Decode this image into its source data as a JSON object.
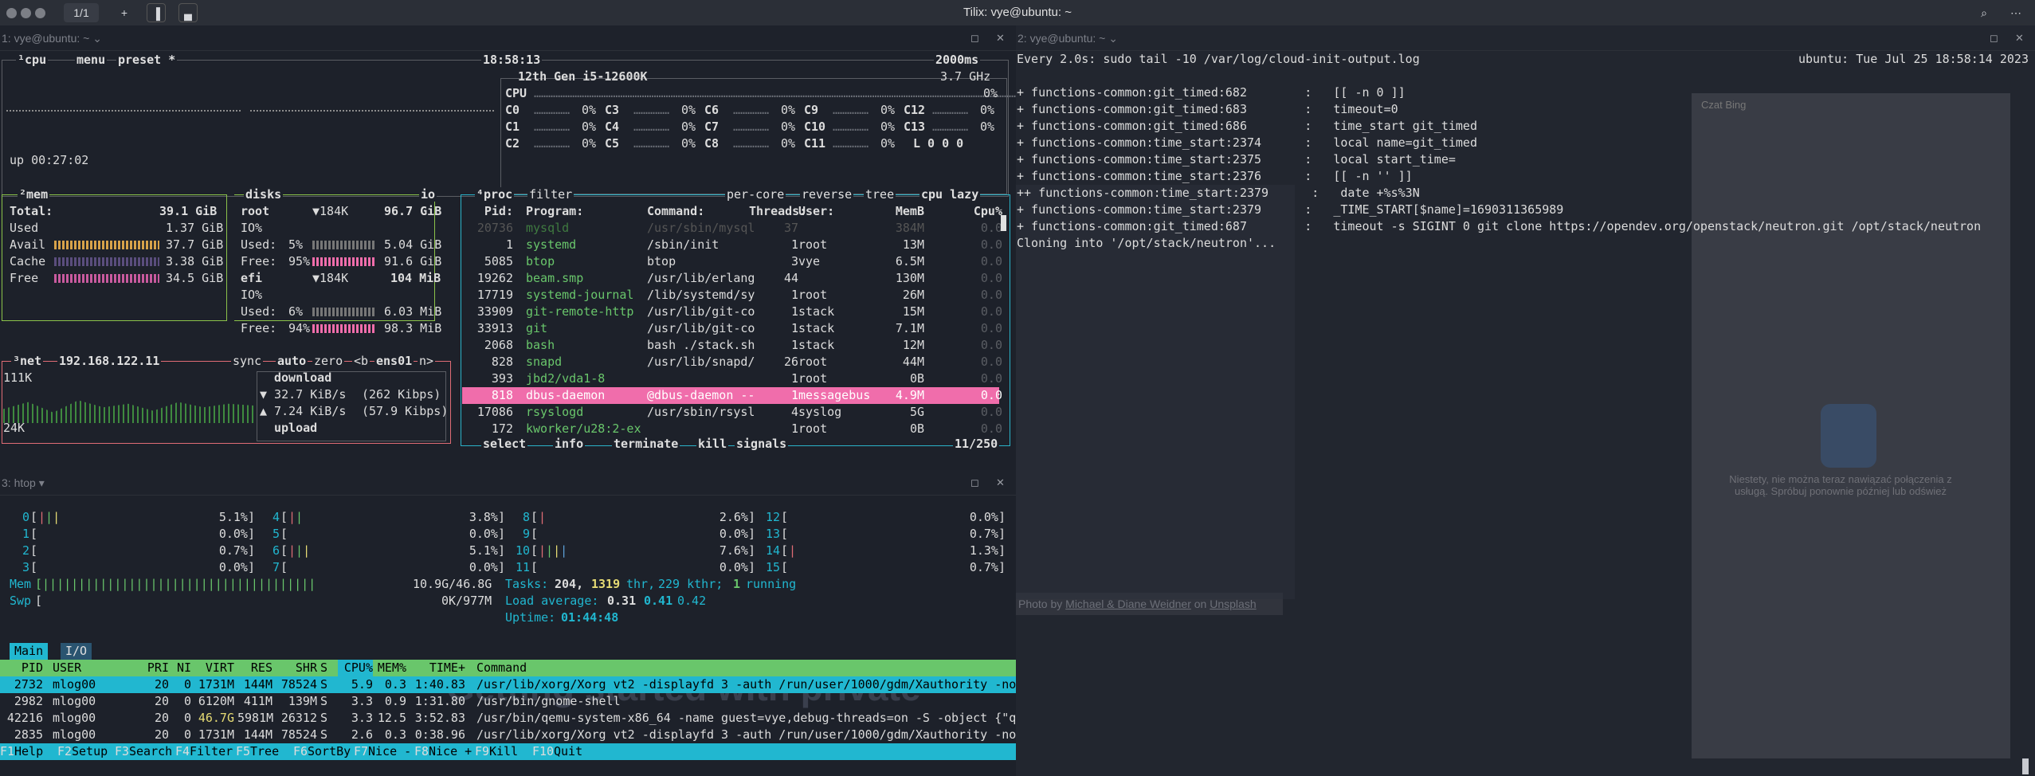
{
  "window": {
    "title": "Tilix: vye@ubuntu: ~",
    "tab": "1/1"
  },
  "pane1": {
    "title": "1: vye@ubuntu: ~"
  },
  "pane2": {
    "title": "2: vye@ubuntu: ~"
  },
  "pane3": {
    "title": "3: htop"
  },
  "btop": {
    "cpu_tab": "¹cpu",
    "menu": "menu",
    "preset": "preset *",
    "clock": "18:58:13",
    "interval": "2000ms",
    "cpu_model": "12th Gen i5-12600K",
    "freq": "3.7 GHz",
    "cpu_label": "CPU",
    "cpu_pct": "0%",
    "cores": [
      [
        "C0",
        "0%"
      ],
      [
        "C1",
        "0%"
      ],
      [
        "C2",
        "0%"
      ],
      [
        "C3",
        "0%"
      ],
      [
        "C4",
        "0%"
      ],
      [
        "C5",
        "0%"
      ],
      [
        "C6",
        "0%"
      ],
      [
        "C7",
        "0%"
      ],
      [
        "C8",
        "0%"
      ],
      [
        "C9",
        "0%"
      ],
      [
        "C10",
        "0%"
      ],
      [
        "C11",
        "0%"
      ],
      [
        "C12",
        "0%"
      ],
      [
        "C13",
        "0%"
      ]
    ],
    "load": "L 0 0 0",
    "uptime": "up 00:27:02",
    "mem": {
      "title": "²mem",
      "total_label": "Total:",
      "total": "39.1 GiB",
      "used_label": "Used",
      "used": "1.37 GiB",
      "avail_label": "Avail",
      "avail": "37.7 GiB",
      "cache_label": "Cache",
      "cache": "3.38 GiB",
      "free_label": "Free",
      "free": "34.5 GiB"
    },
    "disks": {
      "title": "disks",
      "io": "io",
      "root": "root",
      "root_io": "▼184K",
      "root_size": "96.7 GiB",
      "root_io_label": "IO%",
      "root_used_label": "Used:",
      "root_used_pct": "5%",
      "root_used": "5.04 GiB",
      "root_free_label": "Free:",
      "root_free_pct": "95%",
      "root_free": "91.6 GiB",
      "efi": "efi",
      "efi_io": "▼184K",
      "efi_size": "104 MiB",
      "efi_io_label": "IO%",
      "efi_used_label": "Used:",
      "efi_used_pct": "6%",
      "efi_used": "6.03 MiB",
      "efi_free_label": "Free:",
      "efi_free_pct": "94%",
      "efi_free": "98.3 MiB"
    },
    "net": {
      "title": "³net",
      "ip": "192.168.122.11",
      "sync": "sync",
      "auto": "auto",
      "zero": "zero",
      "b": "<b",
      "iface": "ens01",
      "n": "n>",
      "top": "111K",
      "bottom": "24K",
      "download": "download",
      "down_rate": "▼ 32.7 KiB/s",
      "down_kbps": "(262 Kibps)",
      "up_rate": "▲ 7.24 KiB/s",
      "up_kbps": "(57.9 Kibps)",
      "upload": "upload"
    },
    "proc": {
      "title": "⁴proc",
      "filter": "filter",
      "percore": "per-core",
      "reverse": "reverse",
      "tree": "tree",
      "lazy": "cpu lazy",
      "headers": [
        "Pid:",
        "Program:",
        "Command:",
        "Threads:",
        "User:",
        "MemB",
        "Cpu%"
      ],
      "rows": [
        [
          "20736",
          "mysqld",
          "/usr/sbin/mysql",
          "37",
          "",
          "384M",
          "0.0"
        ],
        [
          "1",
          "systemd",
          "/sbin/init",
          "1",
          "root",
          "13M",
          "0.0"
        ],
        [
          "5085",
          "btop",
          "btop",
          "3",
          "vye",
          "6.5M",
          "0.0"
        ],
        [
          "19262",
          "beam.smp",
          "/usr/lib/erlang",
          "44",
          "",
          "130M",
          "0.0"
        ],
        [
          "17719",
          "systemd-journal",
          "/lib/systemd/sy",
          "1",
          "root",
          "26M",
          "0.0"
        ],
        [
          "33909",
          "git-remote-http",
          "/usr/lib/git-co",
          "1",
          "stack",
          "15M",
          "0.0"
        ],
        [
          "33913",
          "git",
          "/usr/lib/git-co",
          "1",
          "stack",
          "7.1M",
          "0.0"
        ],
        [
          "2068",
          "bash",
          "bash ./stack.sh",
          "1",
          "stack",
          "12M",
          "0.0"
        ],
        [
          "828",
          "snapd",
          "/usr/lib/snapd/",
          "26",
          "root",
          "44M",
          "0.0"
        ],
        [
          "393",
          "jbd2/vda1-8",
          "",
          "1",
          "root",
          "0B",
          "0.0"
        ],
        [
          "818",
          "dbus-daemon",
          "@dbus-daemon --",
          "1",
          "messagebus",
          "4.9M",
          "0.0"
        ],
        [
          "17086",
          "rsyslogd",
          "/usr/sbin/rsysl",
          "4",
          "syslog",
          "5G",
          "0.0"
        ],
        [
          "172",
          "kworker/u28:2-ex",
          "",
          "1",
          "root",
          "0B",
          "0.0"
        ]
      ],
      "footer_select": "select",
      "footer_info": "info",
      "footer_terminate": "terminate",
      "footer_kill": "kill",
      "footer_signals": "signals",
      "count": "11/250"
    }
  },
  "watch": {
    "header": "Every 2.0s: sudo tail -10 /var/log/cloud-init-output.log",
    "host": "ubuntu: Tue Jul 25 18:58:14 2023",
    "lines": [
      "+ functions-common:git_timed:682        :   [[ -n 0 ]]",
      "+ functions-common:git_timed:683        :   timeout=0",
      "+ functions-common:git_timed:686        :   time_start git_timed",
      "+ functions-common:time_start:2374      :   local name=git_timed",
      "+ functions-common:time_start:2375      :   local start_time=",
      "+ functions-common:time_start:2376      :   [[ -n '' ]]",
      "++ functions-common:time_start:2379      :   date +%s%3N",
      "+ functions-common:time_start:2379      :   _TIME_START[$name]=1690311365989",
      "+ functions-common:git_timed:687        :   timeout -s SIGINT 0 git clone https://opendev.org/openstack/neutron.git /opt/stack/neutron",
      "Cloning into '/opt/stack/neutron'..."
    ]
  },
  "htop": {
    "cpus": [
      [
        "0",
        "5.1%"
      ],
      [
        "1",
        "0.0%"
      ],
      [
        "2",
        "0.7%"
      ],
      [
        "3",
        "0.0%"
      ],
      [
        "4",
        "3.8%"
      ],
      [
        "5",
        "0.0%"
      ],
      [
        "6",
        "5.1%"
      ],
      [
        "7",
        "0.0%"
      ],
      [
        "8",
        "2.6%"
      ],
      [
        "9",
        "0.0%"
      ],
      [
        "10",
        "7.6%"
      ],
      [
        "11",
        "0.0%"
      ],
      [
        "12",
        "0.0%"
      ],
      [
        "13",
        "0.7%"
      ],
      [
        "14",
        "1.3%"
      ],
      [
        "15",
        "0.7%"
      ]
    ],
    "mem_label": "Mem",
    "mem_val": "10.9G/46.8G",
    "swp_label": "Swp",
    "swp_val": "0K/977M",
    "tasks_label": "Tasks:",
    "tasks": "204,",
    "thr": "1319",
    "thr_label": "thr,",
    "kthr": "229 kthr;",
    "running_n": "1",
    "running": "running",
    "load_label": "Load average:",
    "load1": "0.31",
    "load5": "0.41",
    "load15": "0.42",
    "uptime_label": "Uptime:",
    "uptime": "01:44:48",
    "tab_main": "Main",
    "tab_io": "I/O",
    "headers": [
      "PID",
      "USER",
      "PRI",
      "NI",
      "VIRT",
      "RES",
      "SHR",
      "S",
      "CPU%",
      "MEM%",
      "TIME+",
      "Command"
    ],
    "rows": [
      [
        "2732",
        "mlog00",
        "20",
        "0",
        "1731M",
        "144M",
        "78524",
        "S",
        "5.9",
        "0.3",
        "1:40.83",
        "/usr/lib/xorg/Xorg vt2 -displayfd 3 -auth /run/user/1000/gdm/Xauthority -no"
      ],
      [
        "2982",
        "mlog00",
        "20",
        "0",
        "6120M",
        "411M",
        "139M",
        "S",
        "3.3",
        "0.9",
        "1:31.80",
        "/usr/bin/gnome-shell"
      ],
      [
        "42216",
        "mlog00",
        "20",
        "0",
        "46.7G",
        "5981M",
        "26312",
        "S",
        "3.3",
        "12.5",
        "3:52.83",
        "/usr/bin/qemu-system-x86_64 -name guest=vye,debug-threads=on -S -object {\"q"
      ],
      [
        "2835",
        "mlog00",
        "20",
        "0",
        "1731M",
        "144M",
        "78524",
        "S",
        "2.6",
        "0.3",
        "0:38.96",
        "/usr/lib/xorg/Xorg vt2 -displayfd 3 -auth /run/user/1000/gdm/Xauthority -no"
      ]
    ],
    "fkeys": [
      [
        "F1",
        "Help"
      ],
      [
        "F2",
        "Setup"
      ],
      [
        "F3",
        "Search"
      ],
      [
        "F4",
        "Filter"
      ],
      [
        "F5",
        "Tree"
      ],
      [
        "F6",
        "SortBy"
      ],
      [
        "F7",
        "Nice -"
      ],
      [
        "F8",
        "Nice +"
      ],
      [
        "F9",
        "Kill"
      ],
      [
        "F10",
        "Quit"
      ]
    ]
  },
  "background": {
    "banner": "Getting started with private",
    "bing_msg": "Niestety, nie można teraz nawiązać połączenia z usługą. Spróbuj ponownie później lub odśwież",
    "photo_credit": "Photo by",
    "photo_author": "Michael & Diane Weidner",
    "photo_on": "on",
    "photo_site": "Unsplash",
    "chat_title": "Czat Bing"
  }
}
